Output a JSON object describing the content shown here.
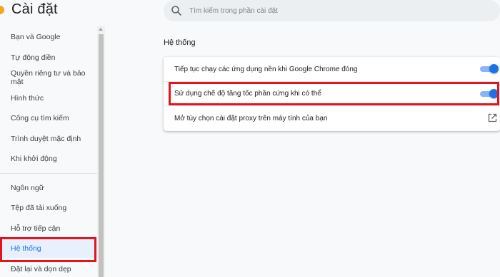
{
  "app": {
    "title": "Cài đặt"
  },
  "search": {
    "placeholder": "Tìm kiếm trong phần cài đặt"
  },
  "sidebar": {
    "items": [
      {
        "label": "Bạn và Google"
      },
      {
        "label": "Tự động điền"
      },
      {
        "label": "Quyền riêng tư và bảo mật"
      },
      {
        "label": "Hình thức"
      },
      {
        "label": "Công cụ tìm kiếm"
      },
      {
        "label": "Trình duyệt mặc định"
      },
      {
        "label": "Khi khởi động"
      },
      {
        "label": "Ngôn ngữ"
      },
      {
        "label": "Tệp đã tải xuống"
      },
      {
        "label": "Hỗ trợ tiếp cận"
      },
      {
        "label": "Hệ thống"
      },
      {
        "label": "Đặt lại và dọn dẹp"
      }
    ],
    "selected": "Hệ thống"
  },
  "main": {
    "section_title": "Hệ thống",
    "rows": [
      {
        "label": "Tiếp tục chạy các ứng dụng nền khi Google Chrome đóng",
        "control": "toggle",
        "on": true
      },
      {
        "label": "Sử dụng chế độ tăng tốc phần cứng khi có thể",
        "control": "toggle",
        "on": true
      },
      {
        "label": "Mở tùy chọn cài đặt proxy trên máy tính của bạn",
        "control": "external-link-icon"
      }
    ]
  },
  "colors": {
    "accent": "#1a73e8",
    "highlight": "#e3141b",
    "logo": "#f4a623"
  }
}
